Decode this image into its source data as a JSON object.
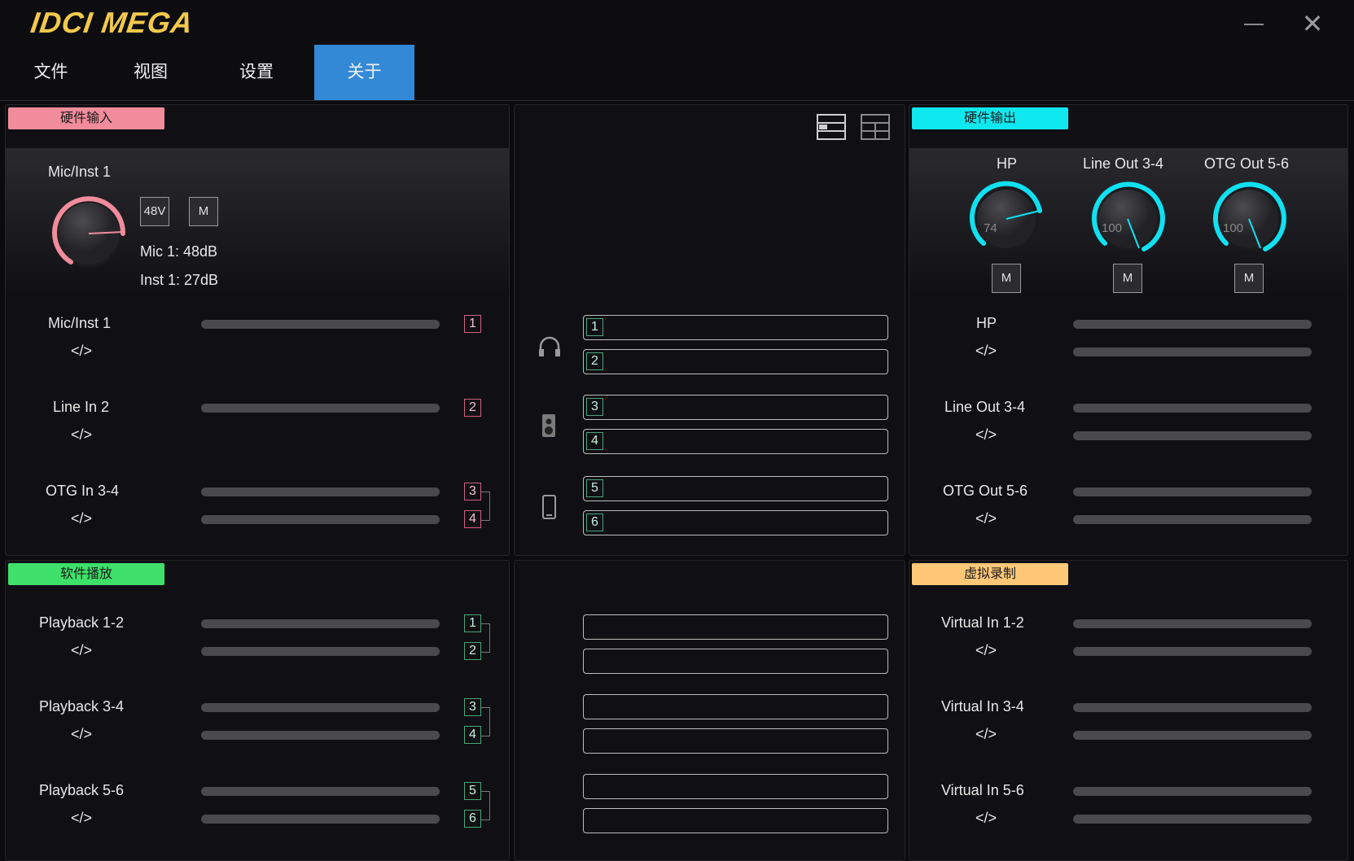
{
  "app": {
    "logo": "IDCI MEGA",
    "close_glyph": "✕"
  },
  "menu": [
    {
      "label": "文件",
      "active": false
    },
    {
      "label": "视图",
      "active": false
    },
    {
      "label": "设置",
      "active": false
    },
    {
      "label": "关于",
      "active": true
    }
  ],
  "hardware_input": {
    "tag": "硬件输入",
    "tag_color": "#f08c9c",
    "channel_title": "Mic/Inst 1",
    "btn_48v": "48V",
    "btn_mute": "M",
    "mic_gain": "Mic 1: 48dB",
    "inst_gain": "Inst 1: 27dB",
    "rows": [
      {
        "name": "Mic/Inst 1",
        "code": "</>",
        "nums": [
          "1"
        ]
      },
      {
        "name": "Line In 2",
        "code": "</>",
        "nums": [
          "2"
        ]
      },
      {
        "name": "OTG In 3-4",
        "code": "</>",
        "nums": [
          "3",
          "4"
        ]
      }
    ]
  },
  "routing": {
    "view_icons": [
      "layout-single-icon",
      "layout-grid-icon"
    ],
    "top_slots": [
      "1",
      "2",
      "3",
      "4",
      "5",
      "6"
    ],
    "group_icons": [
      "headphones-icon",
      "speaker-icon",
      "phone-icon"
    ]
  },
  "hardware_output": {
    "tag": "硬件输出",
    "tag_color": "#10e8f0",
    "knobs": [
      {
        "label": "HP",
        "value": "74",
        "mute": "M"
      },
      {
        "label": "Line Out 3-4",
        "value": "100",
        "mute": "M"
      },
      {
        "label": "OTG Out 5-6",
        "value": "100",
        "mute": "M"
      }
    ],
    "rows": [
      {
        "name": "HP",
        "code": "</>"
      },
      {
        "name": "Line Out 3-4",
        "code": "</>"
      },
      {
        "name": "OTG Out 5-6",
        "code": "</>"
      }
    ]
  },
  "software_playback": {
    "tag": "软件播放",
    "tag_color": "#3ee06a",
    "rows": [
      {
        "name": "Playback 1-2",
        "code": "</>",
        "nums": [
          "1",
          "2"
        ]
      },
      {
        "name": "Playback 3-4",
        "code": "</>",
        "nums": [
          "3",
          "4"
        ]
      },
      {
        "name": "Playback 5-6",
        "code": "</>",
        "nums": [
          "5",
          "6"
        ]
      }
    ]
  },
  "virtual_record": {
    "tag": "虚拟录制",
    "tag_color": "#ffc878",
    "rows": [
      {
        "name": "Virtual In 1-2",
        "code": "</>"
      },
      {
        "name": "Virtual In 3-4",
        "code": "</>"
      },
      {
        "name": "Virtual In 5-6",
        "code": "</>"
      }
    ]
  },
  "colors": {
    "accent": "#3489d6",
    "knob_in": "#f08c9c",
    "knob_out": "#10e0f0"
  }
}
